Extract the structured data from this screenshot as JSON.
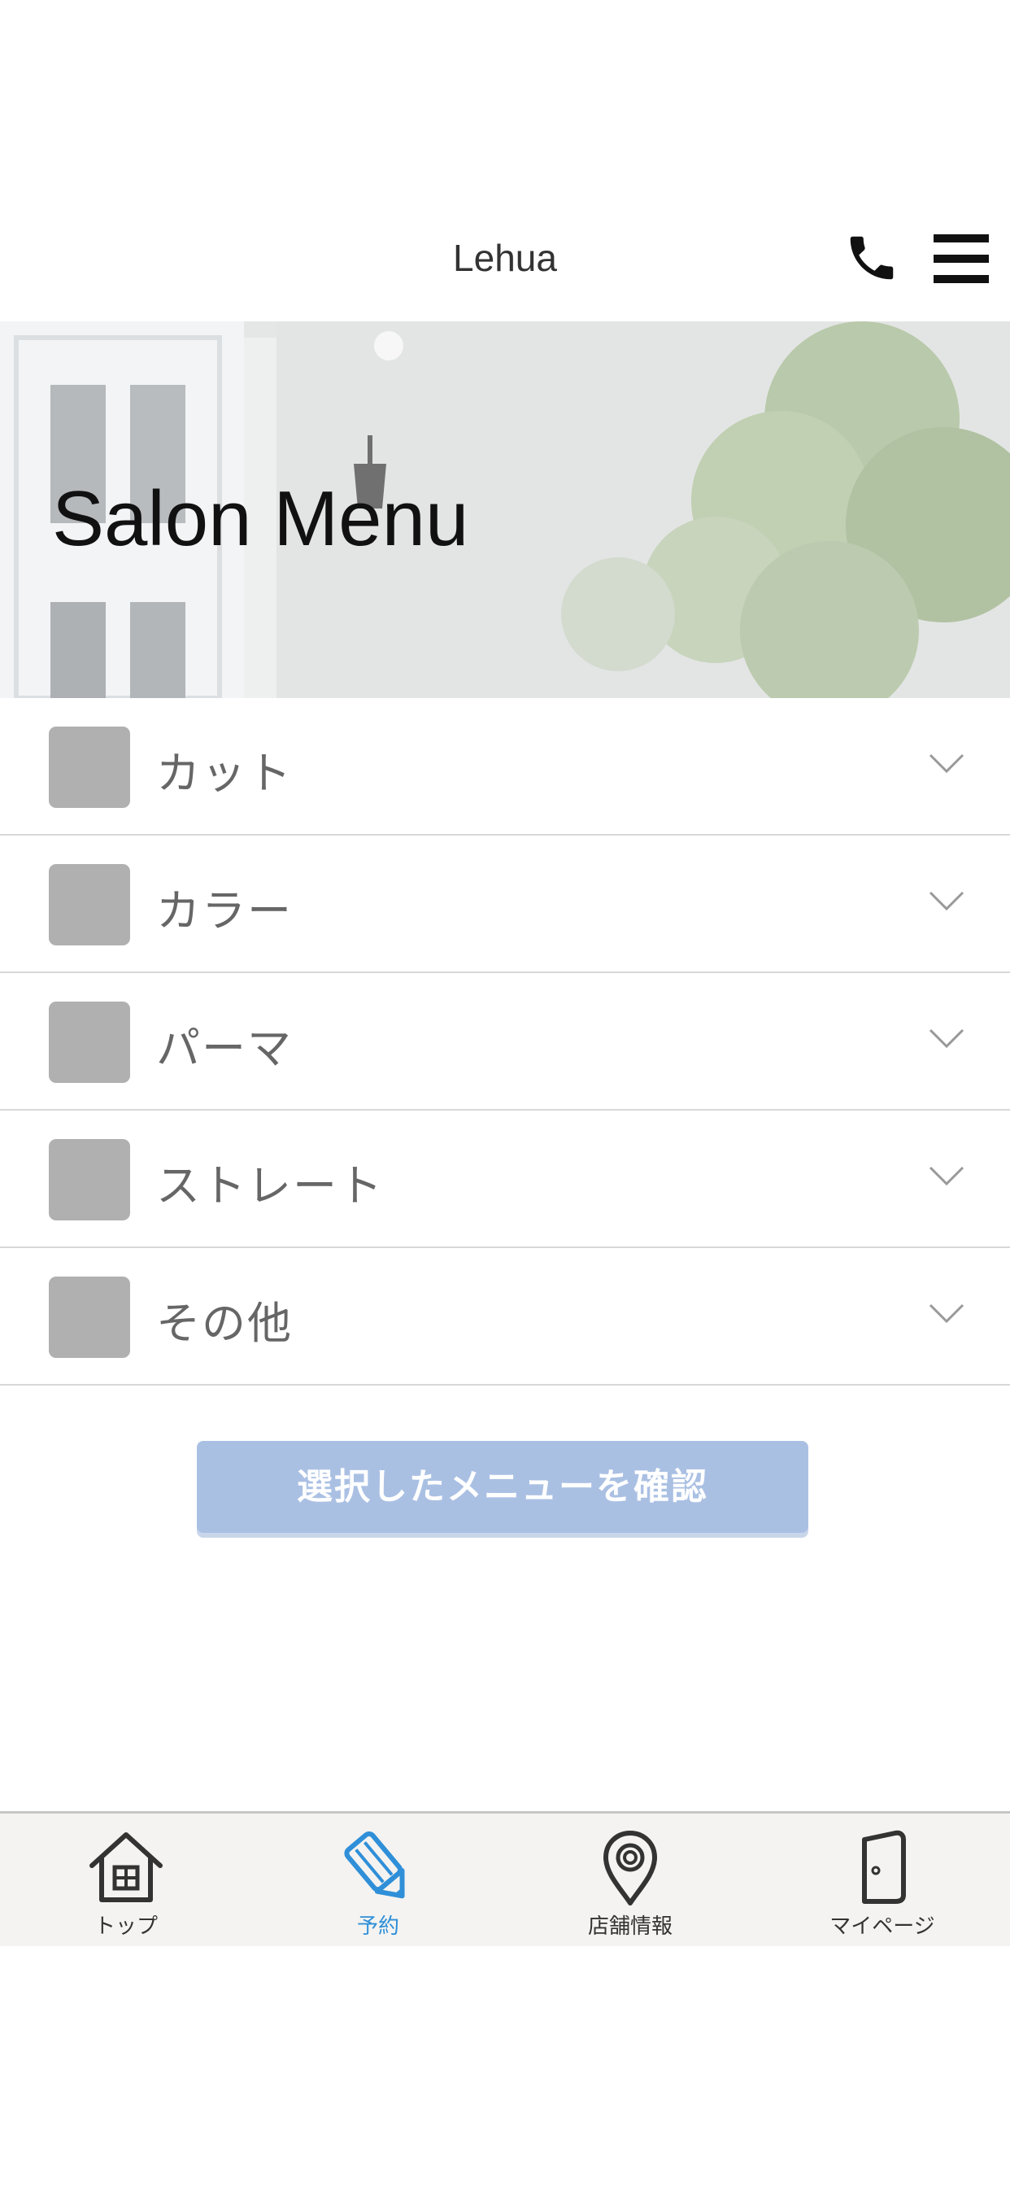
{
  "header": {
    "title": "Lehua",
    "phone_icon": "phone-icon",
    "menu_icon": "hamburger-menu-icon"
  },
  "hero": {
    "title": "Salon Menu"
  },
  "menu": {
    "items": [
      {
        "label": "カット"
      },
      {
        "label": "カラー"
      },
      {
        "label": "パーマ"
      },
      {
        "label": "ストレート"
      },
      {
        "label": "その他"
      }
    ]
  },
  "confirm_button": {
    "label": "選択したメニューを確認"
  },
  "tabbar": {
    "active_color": "#2f8fd8",
    "tabs": [
      {
        "label": "トップ",
        "icon": "home-icon",
        "active": false
      },
      {
        "label": "予約",
        "icon": "pencil-icon",
        "active": true
      },
      {
        "label": "店舗情報",
        "icon": "location-pin-icon",
        "active": false
      },
      {
        "label": "マイページ",
        "icon": "door-icon",
        "active": false
      }
    ]
  }
}
